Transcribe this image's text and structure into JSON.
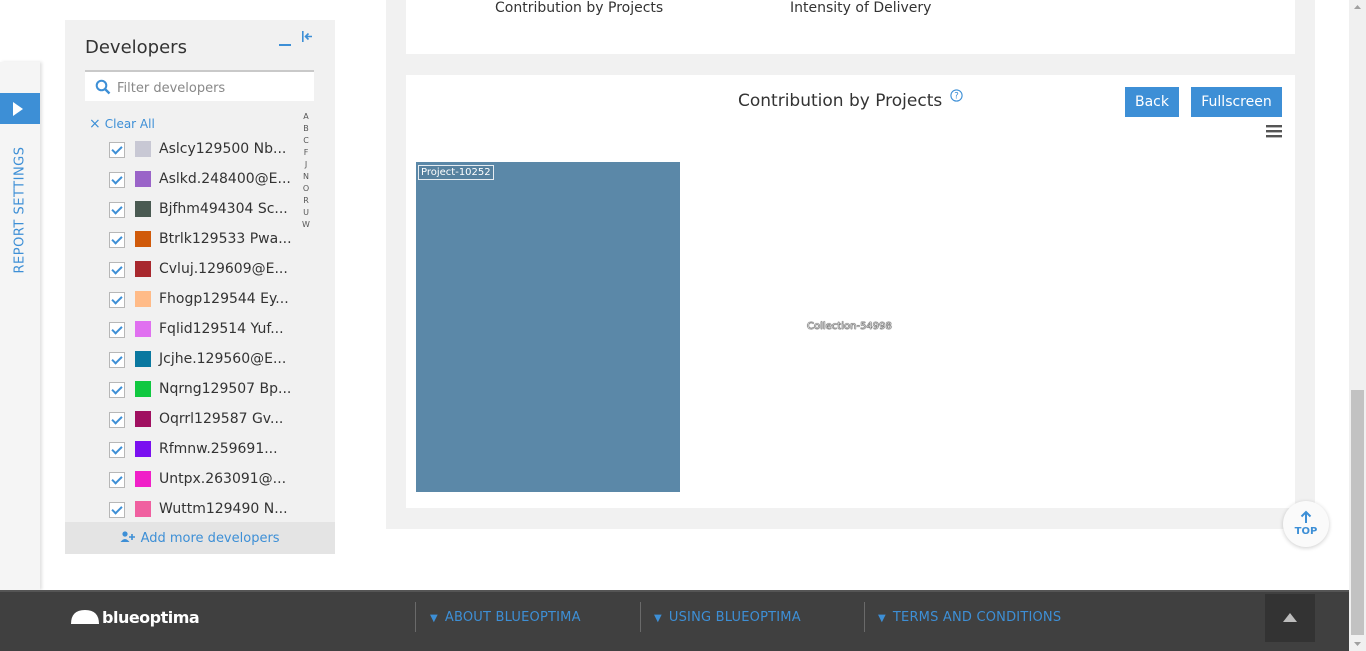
{
  "rail": {
    "label": "REPORT SETTINGS"
  },
  "developers": {
    "title": "Developers",
    "search_placeholder": "Filter developers",
    "clear_all_label": "Clear All",
    "alphabet": [
      "A",
      "B",
      "C",
      "F",
      "J",
      "N",
      "O",
      "R",
      "U",
      "W"
    ],
    "items": [
      {
        "name": "Aslcy129500 Nb...",
        "color": "#c8c8d4"
      },
      {
        "name": "Aslkd.248400@E...",
        "color": "#9a64c8"
      },
      {
        "name": "Bjfhm494304 Sc...",
        "color": "#4a5a52"
      },
      {
        "name": "Btrlk129533 Pwa...",
        "color": "#d05a0a"
      },
      {
        "name": "Cvluj.129609@E...",
        "color": "#a8282e"
      },
      {
        "name": "Fhogp129544 Ey...",
        "color": "#ffbb88"
      },
      {
        "name": "Fqlid129514 Yuf...",
        "color": "#e070f0"
      },
      {
        "name": "Jcjhe.129560@E...",
        "color": "#0a78a0"
      },
      {
        "name": "Nqrng129507 Bp...",
        "color": "#10c840"
      },
      {
        "name": "Oqrrl129587 Gv...",
        "color": "#a01060"
      },
      {
        "name": "Rfmnw.259691...",
        "color": "#7a10f0"
      },
      {
        "name": "Untpx.263091@...",
        "color": "#f020c8"
      },
      {
        "name": "Wuttm129490 N...",
        "color": "#f060a0"
      }
    ],
    "add_more_label": "Add more developers"
  },
  "tabs": {
    "contribution": "Contribution by Projects",
    "intensity": "Intensity of Delivery"
  },
  "chart": {
    "title": "Contribution by Projects",
    "back_label": "Back",
    "fullscreen_label": "Fullscreen",
    "project_label": "Project-10252",
    "collection_label": "Collection-54998",
    "project_color": "#5b88a8"
  },
  "top_button": {
    "label": "TOP"
  },
  "footer": {
    "brand": "blueoptima",
    "links": [
      "ABOUT BLUEOPTIMA",
      "USING BLUEOPTIMA",
      "TERMS AND CONDITIONS"
    ]
  }
}
